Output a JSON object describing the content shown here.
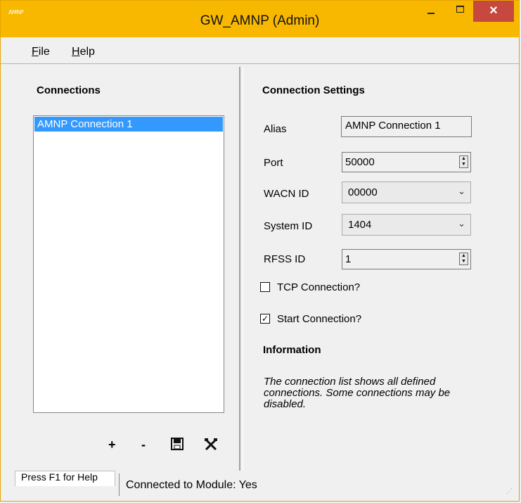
{
  "window": {
    "title": "GW_AMNP (Admin)",
    "app_icon_text": "AMNP",
    "close_glyph": "×"
  },
  "menu": {
    "items": [
      {
        "label": "File",
        "accelerator": "F"
      },
      {
        "label": "Help",
        "accelerator": "H"
      }
    ]
  },
  "connections": {
    "heading": "Connections",
    "items": [
      "AMNP Connection 1"
    ],
    "selected_index": 0,
    "toolbar": {
      "add_label": "+",
      "remove_label": "-",
      "save_icon": "save-icon",
      "tools_icon": "tools-icon"
    }
  },
  "settings": {
    "heading": "Connection Settings",
    "alias": {
      "label": "Alias",
      "value": "AMNP Connection 1"
    },
    "port": {
      "label": "Port",
      "value": "50000"
    },
    "wacn_id": {
      "label": "WACN ID",
      "value": "00000"
    },
    "system_id": {
      "label": "System ID",
      "value": "1404"
    },
    "rfss_id": {
      "label": "RFSS ID",
      "value": "1"
    },
    "tcp_connection": {
      "label": "TCP Connection?",
      "checked": false
    },
    "start_connection": {
      "label": "Start Connection?",
      "checked": true
    }
  },
  "information": {
    "heading": "Information",
    "text": "The connection list shows all defined connections.  Some connections may be disabled."
  },
  "status": {
    "help_text": "Press F1 for Help",
    "module_text": "Connected to Module: Yes"
  },
  "colors": {
    "titlebar": "#f8b800",
    "close_button": "#c7483e",
    "selection": "#3399ff"
  }
}
